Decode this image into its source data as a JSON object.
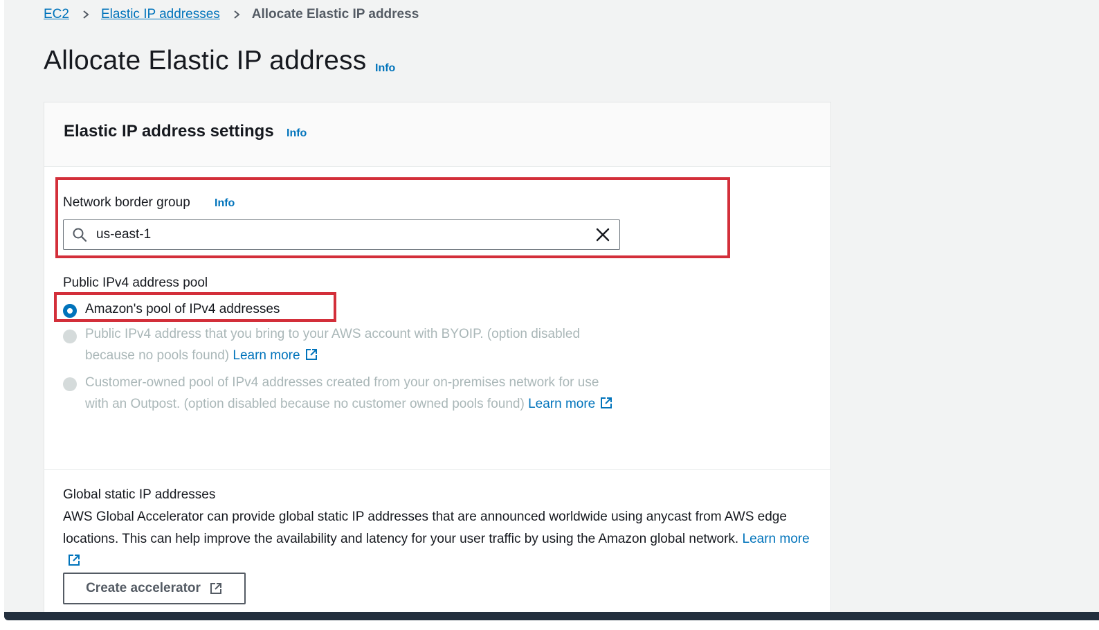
{
  "breadcrumb": {
    "items": [
      "EC2",
      "Elastic IP addresses"
    ],
    "current": "Allocate Elastic IP address"
  },
  "page": {
    "title": "Allocate Elastic IP address",
    "info": "Info"
  },
  "settings": {
    "title": "Elastic IP address settings",
    "info": "Info",
    "network_border_group": {
      "label": "Network border group",
      "info": "Info",
      "value": "us-east-1"
    },
    "ipv4_pool": {
      "label": "Public IPv4 address pool",
      "options": [
        {
          "text": "Amazon's pool of IPv4 addresses",
          "selected": true,
          "disabled": false
        },
        {
          "text": "Public IPv4 address that you bring to your AWS account with BYOIP. (option disabled because no pools found)",
          "link": "Learn more",
          "selected": false,
          "disabled": true
        },
        {
          "text": "Customer-owned pool of IPv4 addresses created from your on-premises network for use with an Outpost. (option disabled because no customer owned pools found)",
          "link": "Learn more",
          "selected": false,
          "disabled": true
        }
      ]
    },
    "global_static": {
      "label": "Global static IP addresses",
      "description": "AWS Global Accelerator can provide global static IP addresses that are announced worldwide using anycast from AWS edge locations. This can help improve the availability and latency for your user traffic by using the Amazon global network.",
      "link": "Learn more",
      "button": "Create accelerator"
    }
  },
  "colors": {
    "link": "#0073bb",
    "highlight": "#d32f3a",
    "disabled_text": "#aab7b8"
  },
  "icons": [
    "chevron-right-icon",
    "search-icon",
    "close-icon",
    "external-link-icon"
  ]
}
